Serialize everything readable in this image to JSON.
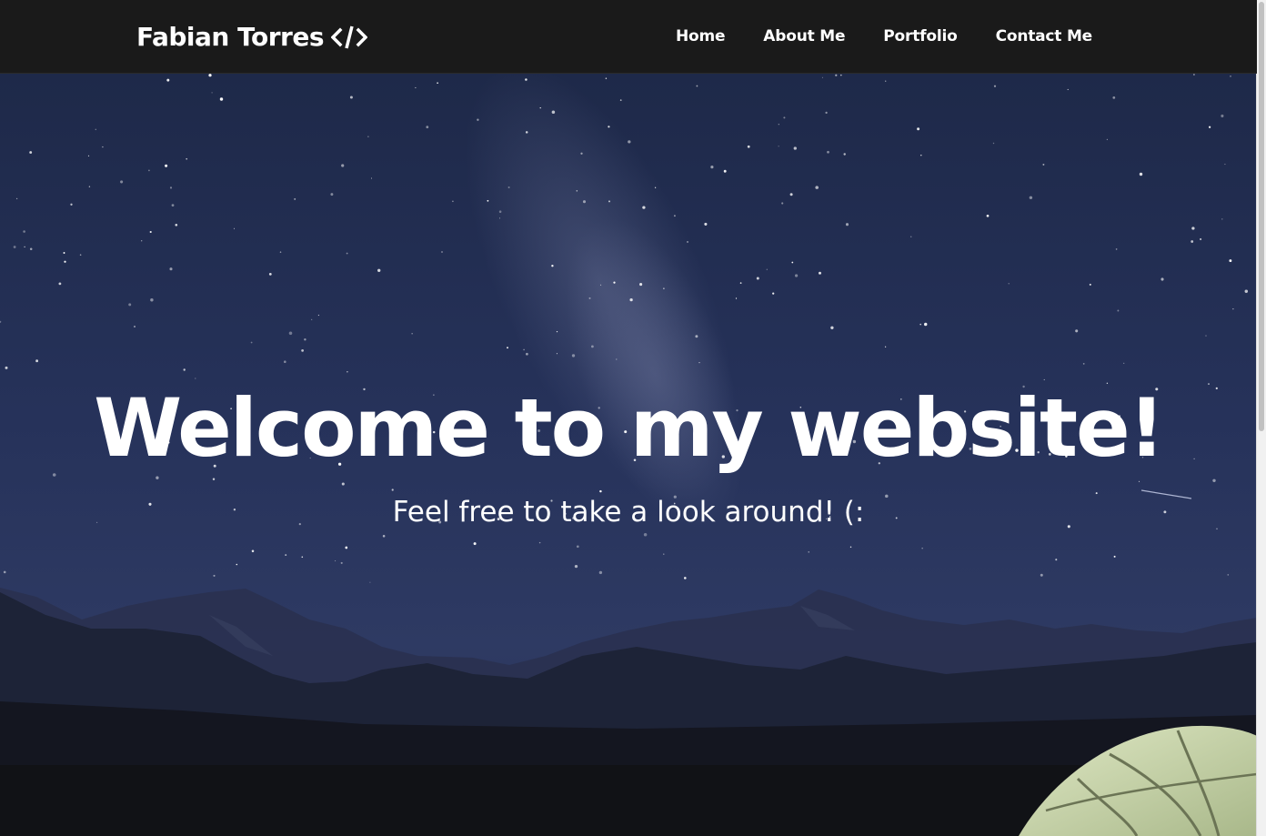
{
  "navbar": {
    "brand_name": "Fabian Torres",
    "brand_icon": "code-brackets-icon",
    "links": [
      {
        "label": "Home"
      },
      {
        "label": "About Me"
      },
      {
        "label": "Portfolio"
      },
      {
        "label": "Contact Me"
      }
    ],
    "background": "#1a1a1a"
  },
  "hero": {
    "title": "Welcome to my website!",
    "subtitle": "Feel free to take a look around! (:",
    "background_image": "starry-night-mountains-tent"
  },
  "colors": {
    "sky_top": "#202c50",
    "sky_mid": "#27335a",
    "mountains": "#1c2236",
    "ground": "#111216",
    "text": "#ffffff"
  }
}
